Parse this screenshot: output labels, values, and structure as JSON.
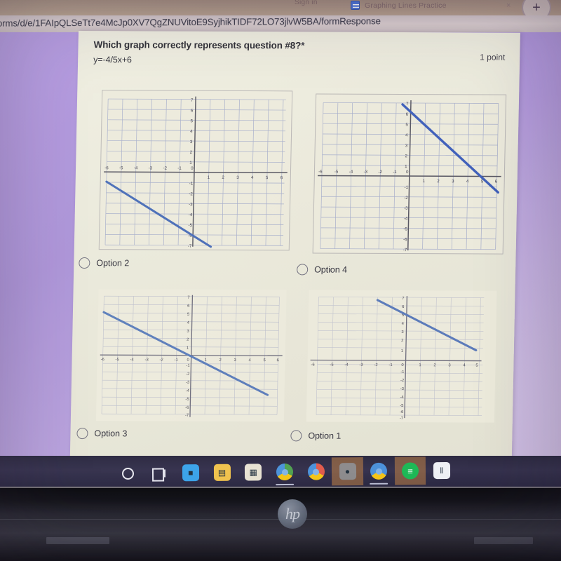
{
  "browser": {
    "tab_title": "Graphing Lines Practice",
    "tab_close_glyph": "×",
    "new_tab_glyph": "+",
    "url": "orms/d/e/1FAIpQLSeTt7e4McJp0XV7QgZNUVitoE9SyjhikTIDF72LO73jlvW5BA/formResponse",
    "ghost_tab_text": "Sign  in"
  },
  "form": {
    "question_title": "Which graph correctly represents question #8?",
    "required_marker": "*",
    "equation": "y=-4/5x+6",
    "points": "1 point",
    "options": [
      {
        "id": "option-2",
        "label": "Option 2"
      },
      {
        "id": "option-4",
        "label": "Option 4"
      },
      {
        "id": "option-3",
        "label": "Option 3"
      },
      {
        "id": "option-1",
        "label": "Option 1"
      }
    ]
  },
  "chart_data": [
    {
      "type": "line",
      "name": "Option 2",
      "position": "top-left",
      "title": "",
      "xlabel": "",
      "ylabel": "",
      "xlim": [
        -6,
        6
      ],
      "ylim": [
        -7,
        7
      ],
      "xticks": [
        -6,
        -5,
        -4,
        -3,
        -2,
        -1,
        0,
        1,
        2,
        3,
        4,
        5,
        6
      ],
      "yticks": [
        -7,
        -6,
        -5,
        -4,
        -3,
        -2,
        -1,
        0,
        1,
        2,
        3,
        4,
        5,
        6,
        7
      ],
      "grid": true,
      "series": [
        {
          "name": "line",
          "slope": -0.8,
          "intercept": -6,
          "x": [
            -6,
            1.25
          ],
          "y": [
            -1.2,
            -7
          ]
        }
      ]
    },
    {
      "type": "line",
      "name": "Option 4",
      "position": "top-right",
      "title": "",
      "xlabel": "",
      "ylabel": "",
      "xlim": [
        -6,
        6
      ],
      "ylim": [
        -7,
        7
      ],
      "xticks": [
        -6,
        -5,
        -4,
        -3,
        -2,
        -1,
        0,
        1,
        2,
        3,
        4,
        5,
        6
      ],
      "yticks": [
        -7,
        -6,
        -5,
        -4,
        -3,
        -2,
        -1,
        0,
        1,
        2,
        3,
        4,
        5,
        6,
        7
      ],
      "grid": true,
      "series": [
        {
          "name": "line",
          "slope": -0.8,
          "intercept": 6,
          "x": [
            -0.6,
            6
          ],
          "y": [
            7.2,
            -2.2
          ]
        }
      ]
    },
    {
      "type": "line",
      "name": "Option 3",
      "position": "bottom-left",
      "title": "",
      "xlabel": "",
      "ylabel": "",
      "xlim": [
        -6,
        6
      ],
      "ylim": [
        -7,
        7
      ],
      "xticks": [
        -6,
        -5,
        -4,
        -3,
        -2,
        -1,
        0,
        1,
        2,
        3,
        4,
        5,
        6
      ],
      "yticks": [
        -7,
        -6,
        -5,
        -4,
        -3,
        -2,
        -1,
        0,
        1,
        2,
        3,
        4,
        5,
        6,
        7
      ],
      "grid": true,
      "series": [
        {
          "name": "line",
          "slope": -0.8,
          "intercept": 0,
          "x": [
            -6,
            6
          ],
          "y": [
            4.8,
            -4.8
          ]
        }
      ]
    },
    {
      "type": "line",
      "name": "Option 1",
      "position": "bottom-right",
      "title": "",
      "xlabel": "",
      "ylabel": "",
      "xlim": [
        -6,
        6
      ],
      "ylim": [
        -7,
        7
      ],
      "xticks": [
        -6,
        -5,
        -4,
        -3,
        -2,
        -1,
        0,
        1,
        2,
        3,
        4,
        5,
        6
      ],
      "yticks": [
        -7,
        -6,
        -5,
        -4,
        -3,
        -2,
        -1,
        0,
        1,
        2,
        3,
        4,
        5,
        6,
        7
      ],
      "grid": true,
      "series": [
        {
          "name": "line",
          "slope": -0.75,
          "intercept": 5.5,
          "x": [
            -2,
            6
          ],
          "y": [
            7,
            1
          ]
        }
      ]
    }
  ],
  "taskbar": {
    "items": [
      {
        "name": "cortana-search-icon",
        "label": "",
        "kind": "ring",
        "active": false,
        "running": false
      },
      {
        "name": "task-view-icon",
        "label": "",
        "kind": "taskview",
        "active": false,
        "running": false
      },
      {
        "name": "zoom-app-icon",
        "label": "",
        "kind": "tile",
        "color": "#3aa0e8",
        "glyph": "■",
        "active": false,
        "running": false
      },
      {
        "name": "file-explorer-icon",
        "label": "",
        "kind": "tile",
        "color": "#f0c14b",
        "glyph": "▤",
        "active": false,
        "running": false
      },
      {
        "name": "microsoft-store-icon",
        "label": "",
        "kind": "tile",
        "color": "#e8e3d2",
        "glyph": "▦",
        "active": false,
        "running": false
      },
      {
        "name": "chrome-icon",
        "label": "",
        "kind": "chrome",
        "color": "#4fa04f",
        "active": false,
        "running": true
      },
      {
        "name": "chrome-icon",
        "label": "",
        "kind": "chrome",
        "color": "#e05a4a",
        "active": false,
        "running": false
      },
      {
        "name": "photos-app-icon",
        "label": "",
        "kind": "tile",
        "color": "#8a8a8a",
        "glyph": "●",
        "active": true,
        "running": false
      },
      {
        "name": "chrome-active-icon",
        "label": "",
        "kind": "chrome",
        "color": "#4a90d9",
        "active": false,
        "running": true
      },
      {
        "name": "spotify-icon",
        "label": "",
        "kind": "spotify",
        "color": "#1db954",
        "active": true,
        "running": false
      },
      {
        "name": "equalizer-app-icon",
        "label": "",
        "kind": "tile",
        "color": "#eef0f5",
        "glyph": "‖",
        "active": false,
        "running": false
      }
    ]
  },
  "device": {
    "brand": "hp"
  },
  "colors": {
    "wallpaper": "#a98fd8",
    "form_card": "#eceadb",
    "line_blue": "#4a6bb5",
    "axis_gray": "#5a5a66",
    "grid_blue": "#9aa4c8",
    "taskbar": "#312e48"
  }
}
